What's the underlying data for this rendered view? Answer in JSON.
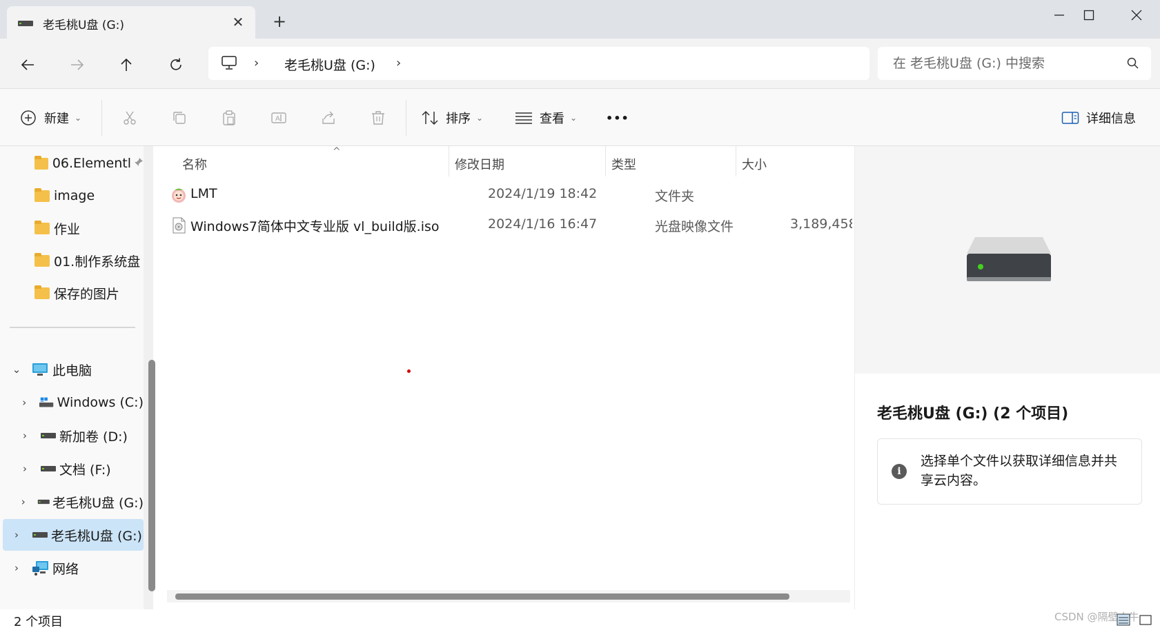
{
  "window": {
    "tab_title": "老毛桃U盘 (G:)",
    "tab_close_glyph": "✕",
    "new_tab_glyph": "+",
    "controls": [
      "minimize",
      "maximize",
      "close"
    ]
  },
  "nav": {
    "back_icon": "arrow-left-icon",
    "forward_icon": "arrow-right-icon",
    "up_icon": "arrow-up-icon",
    "refresh_icon": "refresh-icon",
    "breadcrumb": [
      "此电脑",
      "老毛桃U盘 (G:)"
    ],
    "breadcrumb_sep": "›",
    "search_placeholder": "在 老毛桃U盘 (G:) 中搜索"
  },
  "toolbar": {
    "new_label": "新建",
    "sort_label": "排序",
    "view_label": "查看",
    "more_label": "•••",
    "details_label": "详细信息",
    "dropdown_glyph": "⌄"
  },
  "sidebar": {
    "quick_access": [
      {
        "label": "06.Elementl",
        "pinned": true
      },
      {
        "label": "image"
      },
      {
        "label": "作业"
      },
      {
        "label": "01.制作系统盘"
      },
      {
        "label": "保存的图片"
      }
    ],
    "this_pc": "此电脑",
    "drives": [
      {
        "label": "Windows (C:)"
      },
      {
        "label": "新加卷 (D:)"
      },
      {
        "label": "文档 (F:)"
      },
      {
        "label": "老毛桃U盘 (G:)"
      }
    ],
    "selected_drive": "老毛桃U盘 (G:)",
    "network": "网络",
    "expand_glyph": "›",
    "collapse_glyph": "⌄",
    "pin_glyph": "📌"
  },
  "filelist": {
    "columns": [
      "名称",
      "修改日期",
      "类型",
      "大小"
    ],
    "sort_caret": "^",
    "rows": [
      {
        "name": "LMT",
        "date": "2024/1/19 18:42",
        "type": "文件夹",
        "size": "",
        "icon": "lmt-folder-icon"
      },
      {
        "name": "Windows7简体中文专业版 vl_build版.iso",
        "date": "2024/1/16 16:47",
        "type": "光盘映像文件",
        "size": "3,189,458",
        "icon": "iso-file-icon"
      }
    ]
  },
  "details": {
    "title": "老毛桃U盘 (G:) (2 个项目)",
    "info_glyph": "i",
    "info_text": "选择单个文件以获取详细信息并共享云内容。"
  },
  "status": {
    "item_count": "2 个项目",
    "watermark": "CSDN @隔壁小牛"
  },
  "colors": {
    "selection": "#cce4f7",
    "folder": "#f5c04a",
    "titlebar": "#dfe3e8"
  }
}
